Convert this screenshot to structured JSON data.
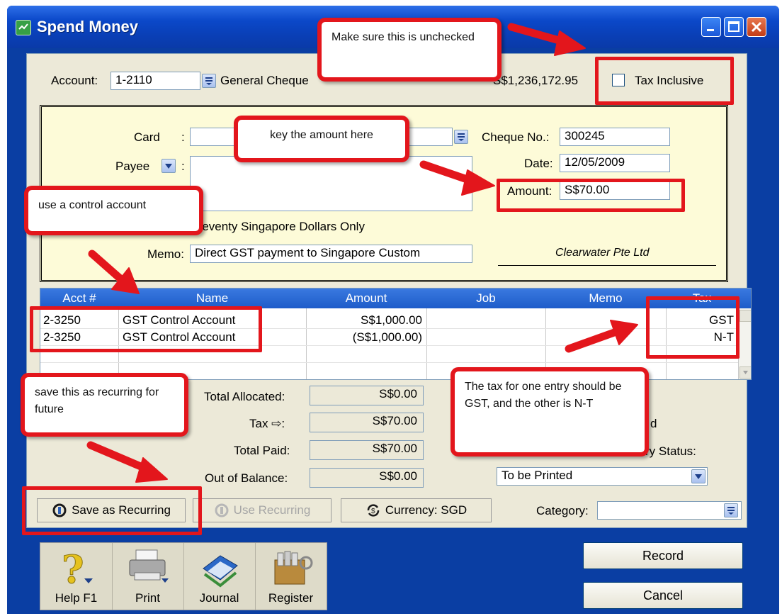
{
  "window": {
    "title": "Spend Money"
  },
  "header": {
    "account_label": "Account:",
    "account_code": "1-2110",
    "account_name": "General Cheque",
    "balance": "S$1,236,172.95",
    "tax_inclusive_label": "Tax Inclusive",
    "tax_inclusive_checked": false
  },
  "cheque": {
    "card_label": "Card",
    "payee_label": "Payee",
    "amount_words": "Seventy Singapore Dollars Only",
    "memo_label": "Memo:",
    "memo_value": "Direct GST payment to Singapore Custom",
    "cheque_no_label": "Cheque No.:",
    "cheque_no": "300245",
    "date_label": "Date:",
    "date": "12/05/2009",
    "amount_label": "Amount:",
    "amount": "S$70.00",
    "company": "Clearwater Pte Ltd"
  },
  "grid": {
    "columns": [
      "Acct #",
      "Name",
      "Amount",
      "Job",
      "Memo",
      "Tax"
    ],
    "rows": [
      {
        "acct": "2-3250",
        "name": "GST Control Account",
        "amount": "S$1,000.00",
        "job": "",
        "memo": "",
        "tax": "GST"
      },
      {
        "acct": "2-3250",
        "name": "GST Control Account",
        "amount": "(S$1,000.00)",
        "job": "",
        "memo": "",
        "tax": "N-T"
      }
    ]
  },
  "totals": {
    "allocated_label": "Total Allocated:",
    "allocated": "S$0.00",
    "tax_label": "Tax ⇨:",
    "tax": "S$70.00",
    "paid_label": "Total Paid:",
    "paid": "S$70.00",
    "out_label": "Out of Balance:",
    "out": "S$0.00",
    "right_partial": "d",
    "delivery_label_partial": "ry Status:",
    "delivery_value": "To be Printed"
  },
  "actions": {
    "save_recurring": "Save as Recurring",
    "use_recurring": "Use Recurring",
    "currency": "Currency:  SGD",
    "category_label": "Category:"
  },
  "toolbar": {
    "help": "Help F1",
    "print": "Print",
    "journal": "Journal",
    "register": "Register"
  },
  "buttons": {
    "record": "Record",
    "cancel": "Cancel"
  },
  "annotations": {
    "tax_inclusive": "Make sure this is unchecked",
    "amount": "key the amount here",
    "control_account": "use a control account",
    "recurring": "save this as recurring for future",
    "tax_entries": "The tax for one entry should be GST, and the other is N-T"
  },
  "colors": {
    "annotation_red": "#e3161c",
    "title_blue": "#0b48c9",
    "grid_header_blue": "#1e5cc9",
    "cheque_yellow": "#fdfbd8"
  }
}
